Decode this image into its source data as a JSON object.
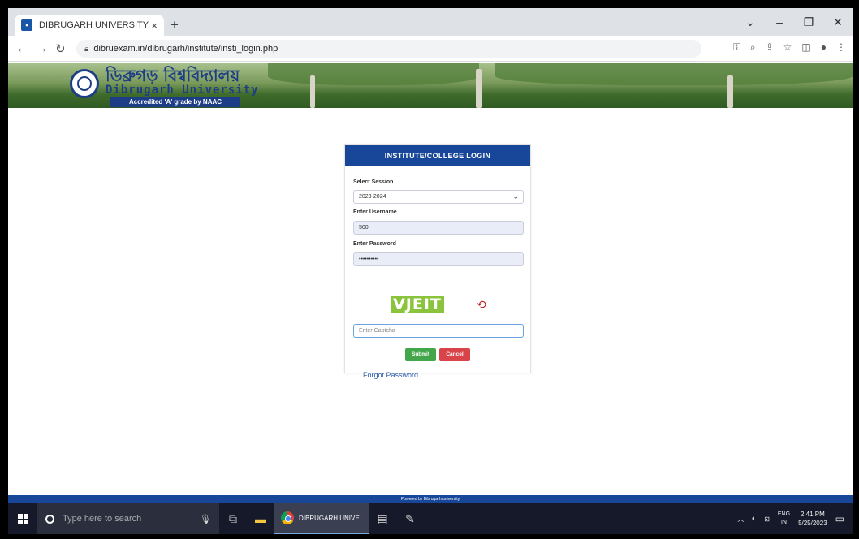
{
  "browser": {
    "tab_title": "DIBRUGARH UNIVERSITY",
    "tab_close": "×",
    "new_tab": "+",
    "url": "dibruexam.in/dibrugarh/institute/insti_login.php",
    "window_controls": [
      "⌄",
      "–",
      "❐",
      "✕"
    ]
  },
  "banner": {
    "bengali_title": "ডিব্ৰুগড় বিশ্ববিদ্যালয়",
    "english_title": "Dibrugarh University",
    "accreditation": "Accredited 'A' grade by NAAC"
  },
  "login": {
    "heading": "INSTITUTE/COLLEGE LOGIN",
    "session_label": "Select Session",
    "session_value": "2023-2024",
    "username_label": "Enter Username",
    "username_value": "500",
    "password_label": "Enter Password",
    "password_value": "••••••••••",
    "captcha_text": "VJEIT",
    "captcha_placeholder": "Enter Captcha",
    "submit_label": "Submit",
    "cancel_label": "Cancel",
    "forgot_label": "Forgot Password"
  },
  "footer": {
    "text": "Powered by Dibrugarh university"
  },
  "taskbar": {
    "search_placeholder": "Type here to search",
    "app_label": "DIBRUGARH UNIVE...",
    "lang_top": "ENG",
    "lang_bottom": "IN",
    "time": "2:41 PM",
    "date": "5/25/2023"
  },
  "colors": {
    "header_blue": "#18479a",
    "submit_green": "#44a64b",
    "cancel_red": "#d9444a",
    "captcha_green": "#8ac43c"
  }
}
